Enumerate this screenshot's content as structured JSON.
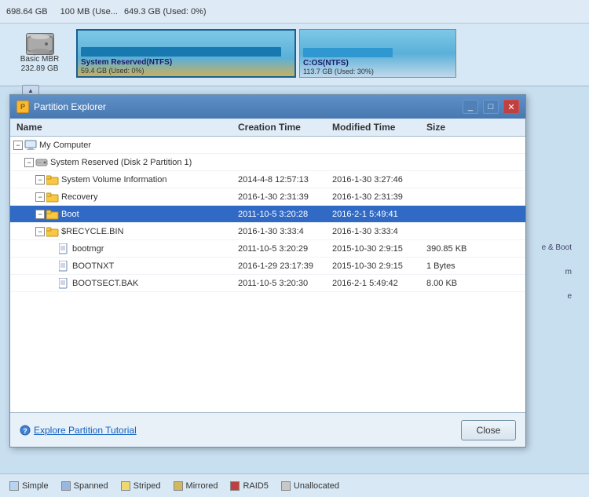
{
  "background": {
    "disk_rows": [
      {
        "label": "698.64 GB",
        "bar_text": "100 MB (Use...",
        "bar_text2": "649.3 GB (Used: 0%)"
      }
    ]
  },
  "disk_visual": {
    "disk_label": "Basic MBR",
    "disk_size": "232.89 GB",
    "partitions": [
      {
        "name": "System Reserved(NTFS)",
        "detail": "59.4 GB (Used: 0%)",
        "type": "system-reserved"
      },
      {
        "name": "C:OS(NTFS)",
        "detail": "113.7 GB (Used: 30%)",
        "type": "c-os"
      }
    ]
  },
  "legend": {
    "items": [
      {
        "label": "Simple",
        "type": "simple"
      },
      {
        "label": "Spanned",
        "type": "spanned"
      },
      {
        "label": "Striped",
        "type": "striped"
      },
      {
        "label": "Mirrored",
        "type": "mirrored"
      },
      {
        "label": "RAID5",
        "type": "raid5"
      },
      {
        "label": "Unallocated",
        "type": "unallocated"
      }
    ]
  },
  "modal": {
    "title": "Partition Explorer",
    "columns": {
      "name": "Name",
      "creation": "Creation Time",
      "modified": "Modified Time",
      "size": "Size"
    },
    "tree": [
      {
        "indent": 0,
        "expand": false,
        "icon": "computer",
        "label": "My Computer",
        "creation": "",
        "modified": "",
        "size": "",
        "selected": false
      },
      {
        "indent": 1,
        "expand": false,
        "icon": "hdd",
        "label": "System Reserved (Disk 2 Partition 1)",
        "creation": "",
        "modified": "",
        "size": "",
        "selected": false
      },
      {
        "indent": 2,
        "expand": true,
        "icon": "folder",
        "label": "System Volume Information",
        "creation": "2014-4-8 12:57:13",
        "modified": "2016-1-30 3:27:46",
        "size": "",
        "selected": false
      },
      {
        "indent": 2,
        "expand": true,
        "icon": "folder",
        "label": "Recovery",
        "creation": "2016-1-30 2:31:39",
        "modified": "2016-1-30 2:31:39",
        "size": "",
        "selected": false
      },
      {
        "indent": 2,
        "expand": true,
        "icon": "folder",
        "label": "Boot",
        "creation": "2011-10-5 3:20:28",
        "modified": "2016-2-1 5:49:41",
        "size": "",
        "selected": true
      },
      {
        "indent": 2,
        "expand": true,
        "icon": "folder",
        "label": "$RECYCLE.BIN",
        "creation": "2016-1-30 3:33:4",
        "modified": "2016-1-30 3:33:4",
        "size": "",
        "selected": false
      },
      {
        "indent": 3,
        "expand": false,
        "icon": "file",
        "label": "bootmgr",
        "creation": "2011-10-5 3:20:29",
        "modified": "2015-10-30 2:9:15",
        "size": "390.85 KB",
        "selected": false
      },
      {
        "indent": 3,
        "expand": false,
        "icon": "file",
        "label": "BOOTNXT",
        "creation": "2016-1-29 23:17:39",
        "modified": "2015-10-30 2:9:15",
        "size": "1 Bytes",
        "selected": false
      },
      {
        "indent": 3,
        "expand": false,
        "icon": "file",
        "label": "BOOTSECT.BAK",
        "creation": "2011-10-5 3:20:30",
        "modified": "2016-2-1 5:49:42",
        "size": "8.00 KB",
        "selected": false
      }
    ],
    "footer": {
      "link_text": "Explore Partition Tutorial",
      "close_btn": "Close"
    }
  }
}
